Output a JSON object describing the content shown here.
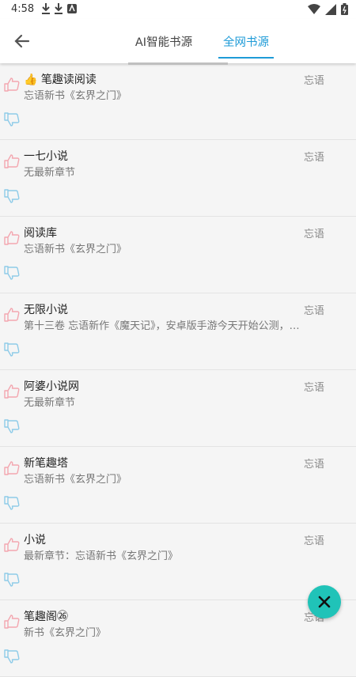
{
  "status_bar": {
    "time": "4:58",
    "left_icons": [
      "download-icon",
      "download-icon",
      "app-notification-icon"
    ],
    "right_icons": [
      "wifi-icon",
      "signal-icon",
      "battery-icon"
    ]
  },
  "appbar": {
    "back_icon": "arrow-left-icon",
    "tabs": [
      {
        "label": "AI智能书源",
        "active": false
      },
      {
        "label": "全网书源",
        "active": true
      }
    ]
  },
  "colors": {
    "accent": "#1e9bd7",
    "like": "#f3a7b0",
    "dislike": "#8ecbe8",
    "fab": "#20c3b8"
  },
  "sources": [
    {
      "title": "👍 笔趣读阅读",
      "latest": "忘语新书《玄界之门》",
      "author": "忘语"
    },
    {
      "title": "一七小说",
      "latest": "无最新章节",
      "author": "忘语"
    },
    {
      "title": "阅读库",
      "latest": "忘语新书《玄界之门》",
      "author": "忘语"
    },
    {
      "title": "无限小说",
      "latest": "第十三卷 忘语新作《魔天记》，安卓版手游今天开始公测，…",
      "author": "忘语"
    },
    {
      "title": "阿婆小说网",
      "latest": "无最新章节",
      "author": "忘语"
    },
    {
      "title": "新笔趣塔",
      "latest": "忘语新书《玄界之门》",
      "author": "忘语"
    },
    {
      "title": "小说",
      "latest": "最新章节：忘语新书《玄界之门》",
      "author": "忘语"
    },
    {
      "title": "笔趣阁㉖",
      "latest": "新书《玄界之门》",
      "author": "忘语"
    }
  ],
  "fab_icon": "close-icon"
}
